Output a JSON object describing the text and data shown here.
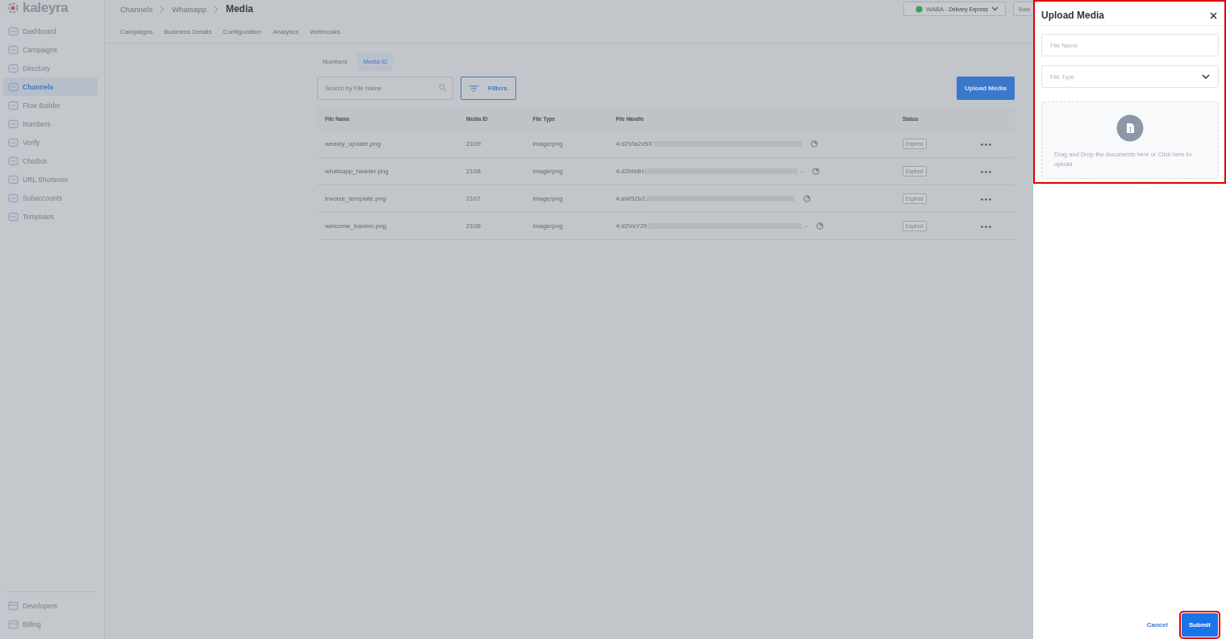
{
  "brand": {
    "name": "kaleyra"
  },
  "sidebar": {
    "items": [
      {
        "label": "Dashboard",
        "selected": false
      },
      {
        "label": "Campaigns",
        "selected": false
      },
      {
        "label": "Directory",
        "selected": false
      },
      {
        "label": "Channels",
        "selected": true
      },
      {
        "label": "Flow Builder",
        "selected": false
      },
      {
        "label": "Numbers",
        "selected": false
      },
      {
        "label": "Verify",
        "selected": false
      },
      {
        "label": "Chatbot",
        "selected": false
      },
      {
        "label": "URL Shortener",
        "selected": false
      },
      {
        "label": "Subaccounts",
        "selected": false
      },
      {
        "label": "Templates",
        "selected": false
      }
    ],
    "bottom_items": [
      {
        "label": "Developers",
        "selected": false
      },
      {
        "label": "Billing",
        "selected": false
      }
    ]
  },
  "breadcrumb": [
    {
      "label": "Channels",
      "current": false
    },
    {
      "label": "Whatsapp",
      "current": false
    },
    {
      "label": "Media",
      "current": true
    }
  ],
  "account_selector": {
    "label": "WABA -",
    "value": "Delivery Express"
  },
  "balance_button": {
    "label": "Bala"
  },
  "nav_tabs": [
    {
      "label": "Campaigns",
      "selected": false
    },
    {
      "label": "Business Details",
      "selected": false
    },
    {
      "label": "Configuration",
      "selected": false
    },
    {
      "label": "Analytics",
      "selected": false
    },
    {
      "label": "Webhooks",
      "selected": false
    }
  ],
  "sub_tabs": [
    {
      "label": "Numbers",
      "selected": false
    },
    {
      "label": "Media ID",
      "selected": true
    }
  ],
  "search": {
    "placeholder": "Search by File Name"
  },
  "filters_button": {
    "label": "Filters"
  },
  "upload_button": {
    "label": "Upload Media"
  },
  "table": {
    "columns": [
      "File Name",
      "Media ID",
      "File Type",
      "File Handle",
      "Status"
    ],
    "rows": [
      {
        "file_name": "weekly_update.png",
        "media_id": "2109",
        "file_type": "image/png",
        "file_handle": "4:d2Vla2x5X",
        "truncated": false,
        "status": "Expired"
      },
      {
        "file_name": "whatsapp_header.png",
        "media_id": "2108",
        "file_type": "image/png",
        "file_handle": "4:d2hhdH",
        "truncated": true,
        "status": "Expired"
      },
      {
        "file_name": "invoice_template.png",
        "media_id": "2107",
        "file_type": "image/png",
        "file_handle": "4:aW52b2",
        "truncated": false,
        "status": "Expired"
      },
      {
        "file_name": "welcome_banner.png",
        "media_id": "2106",
        "file_type": "image/png",
        "file_handle": "4:d2VsY29",
        "truncated": true,
        "status": "Expired"
      }
    ]
  },
  "panel": {
    "title": "Upload Media",
    "highlighted": true,
    "file_name": {
      "placeholder": "File Name"
    },
    "file_type": {
      "placeholder": "File Type"
    },
    "dropzone": {
      "text": "Drag and Drop the documents here or Click here to upload"
    },
    "cancel": {
      "label": "Cancel"
    },
    "submit": {
      "label": "Submit",
      "highlighted": true
    }
  }
}
